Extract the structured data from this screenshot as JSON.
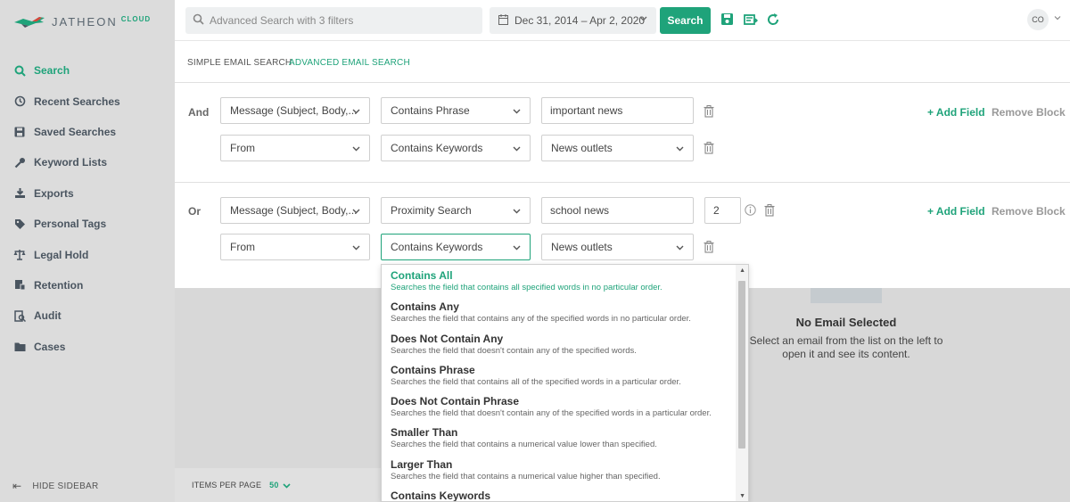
{
  "brand": {
    "name": "JATHEON",
    "suffix": "CLOUD",
    "accent": "#1fa37a"
  },
  "sidebar": {
    "items": [
      {
        "label": "Search",
        "icon": "search-icon",
        "active": true
      },
      {
        "label": "Recent Searches",
        "icon": "history-icon"
      },
      {
        "label": "Saved Searches",
        "icon": "save-icon"
      },
      {
        "label": "Keyword Lists",
        "icon": "key-icon"
      },
      {
        "label": "Exports",
        "icon": "download-icon"
      },
      {
        "label": "Personal Tags",
        "icon": "tag-icon"
      },
      {
        "label": "Legal Hold",
        "icon": "scale-icon"
      },
      {
        "label": "Retention",
        "icon": "retention-icon"
      },
      {
        "label": "Audit",
        "icon": "audit-icon"
      },
      {
        "label": "Cases",
        "icon": "folder-icon"
      }
    ],
    "hide_label": "HIDE SIDEBAR"
  },
  "topbar": {
    "search_placeholder": "Advanced Search with 3 filters",
    "date_range": "Dec 31, 2014 – Apr 2, 2020",
    "search_button": "Search",
    "avatar": "CO"
  },
  "tabs": [
    {
      "label": "SIMPLE EMAIL SEARCH"
    },
    {
      "label": "ADVANCED EMAIL SEARCH",
      "active": true
    }
  ],
  "blocks": [
    {
      "operator": "And",
      "rows": [
        {
          "field": "Message (Subject, Body,...",
          "condition": "Contains Phrase",
          "value": "important news",
          "value_type": "input"
        },
        {
          "field": "From",
          "condition": "Contains Keywords",
          "value": "News outlets",
          "value_type": "select"
        }
      ],
      "add_field": "+ Add Field",
      "remove_block": "Remove Block"
    },
    {
      "operator": "Or",
      "rows": [
        {
          "field": "Message (Subject, Body,...",
          "condition": "Proximity Search",
          "value": "school news",
          "value_type": "input",
          "distance": "2"
        },
        {
          "field": "From",
          "condition": "Contains Keywords",
          "value": "News outlets",
          "value_type": "select"
        }
      ],
      "add_field": "+ Add Field",
      "remove_block": "Remove Block"
    }
  ],
  "dropdown": {
    "options": [
      {
        "title": "Contains All",
        "desc": "Searches the field that contains all specified words in no particular order.",
        "selected": true
      },
      {
        "title": "Contains Any",
        "desc": "Searches the field that contains any of the specified words in no particular order."
      },
      {
        "title": "Does Not Contain Any",
        "desc": "Searches the field that doesn't contain any of the specified words."
      },
      {
        "title": "Contains Phrase",
        "desc": "Searches the field that contains all of the specified words in a particular order."
      },
      {
        "title": "Does Not Contain Phrase",
        "desc": "Searches the field that doesn't contain any of the specified words in a particular order."
      },
      {
        "title": "Smaller Than",
        "desc": "Searches the field that contains a numerical value lower than specified."
      },
      {
        "title": "Larger Than",
        "desc": "Searches the field that contains a numerical value higher than specified."
      },
      {
        "title": "Contains Keywords",
        "desc": ""
      }
    ]
  },
  "preview": {
    "title": "No Email Selected",
    "desc": "Select an email from the list on the left to open it and see its content."
  },
  "list_footer": {
    "items_per_page_label": "ITEMS PER PAGE",
    "items_per_page_value": "50"
  }
}
